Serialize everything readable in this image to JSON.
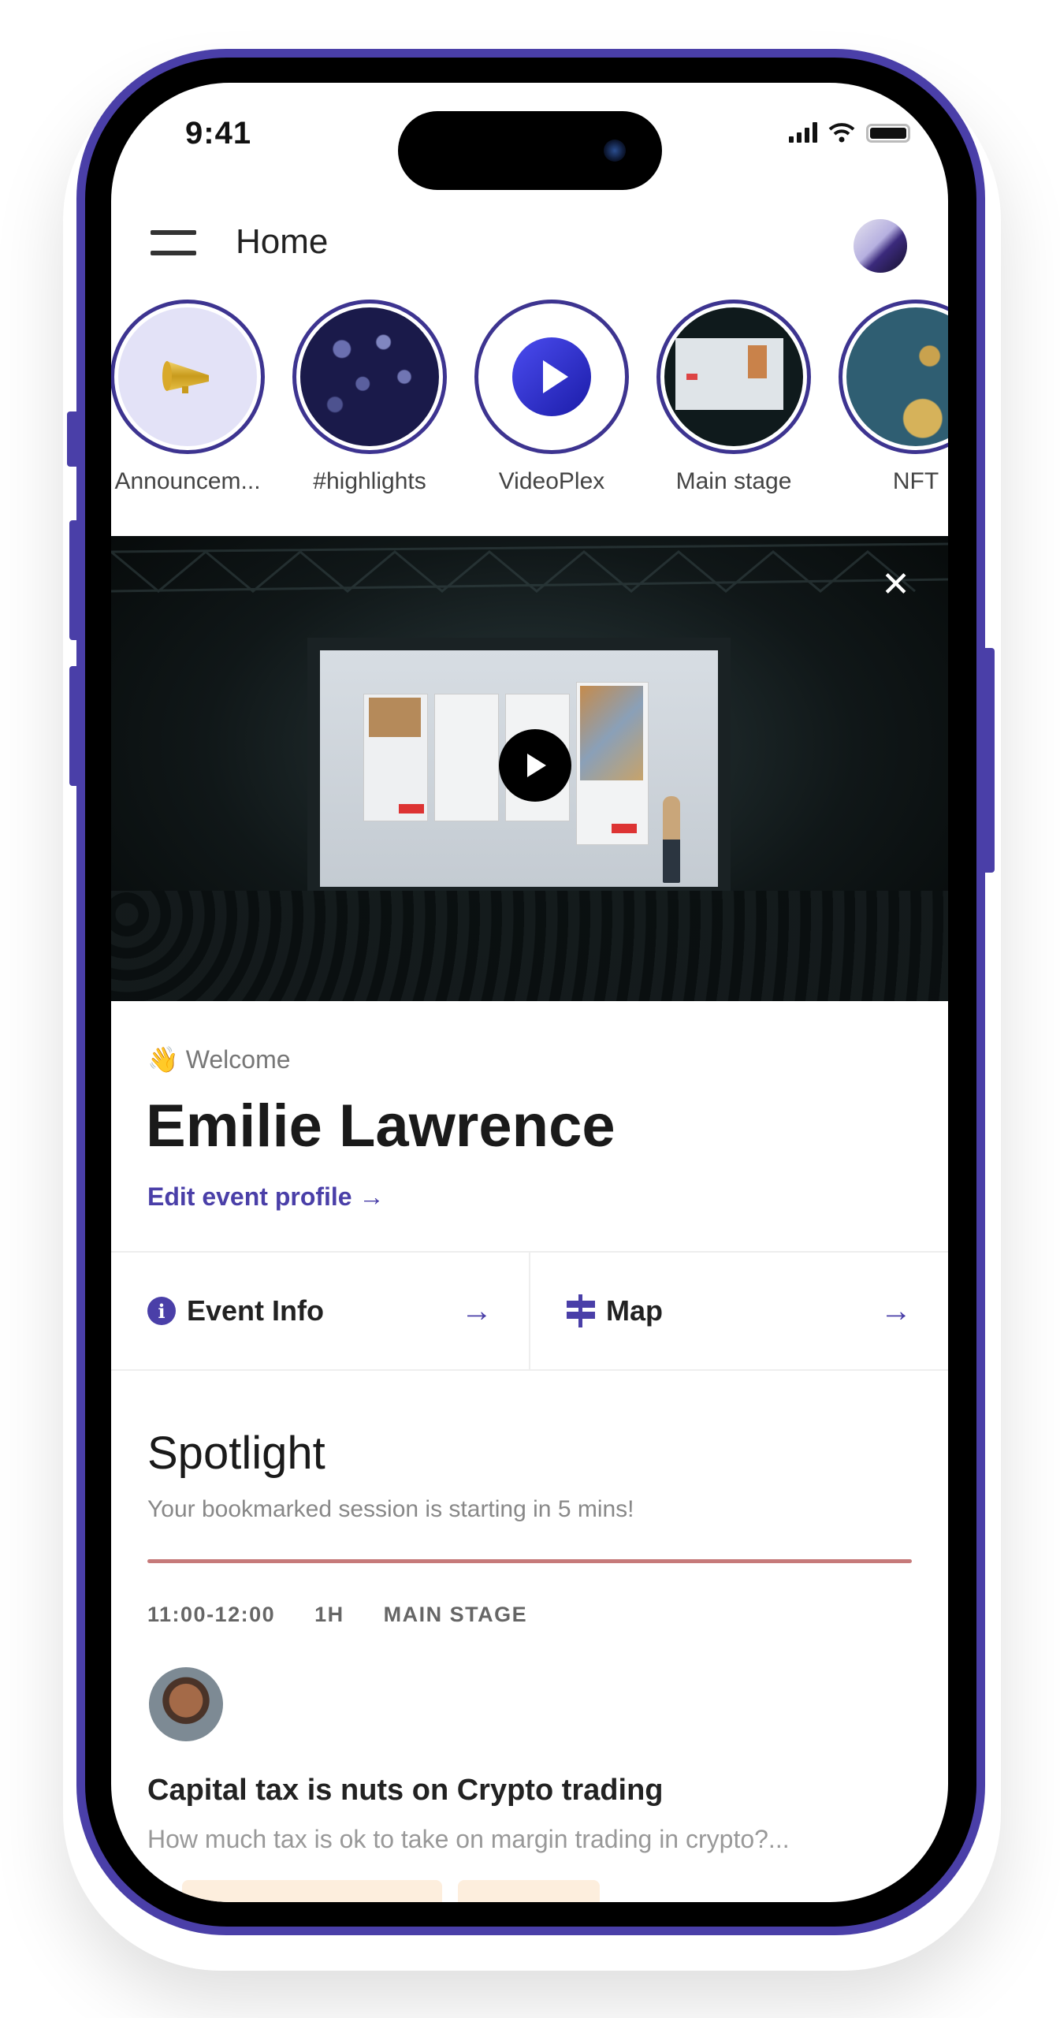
{
  "status_bar": {
    "time": "9:41",
    "icons": [
      "signal-icon",
      "wifi-icon",
      "battery-icon"
    ]
  },
  "header": {
    "title": "Home",
    "menu_icon": "hamburger-menu-icon",
    "avatar": "user-avatar"
  },
  "stories": [
    {
      "label": "Announcem...",
      "icon": "megaphone-icon"
    },
    {
      "label": "#highlights",
      "icon": "crowd-thumbnail"
    },
    {
      "label": "VideoPlex",
      "icon": "play-logo-icon"
    },
    {
      "label": "Main stage",
      "icon": "stage-thumbnail"
    },
    {
      "label": "NFT",
      "icon": "nft-thumbnail"
    }
  ],
  "video": {
    "play_icon": "play-icon",
    "close_icon": "close-icon",
    "close_glyph": "✕"
  },
  "welcome": {
    "greeting_emoji": "👋",
    "greeting": "Welcome",
    "name": "Emilie Lawrence",
    "edit_link": "Edit event profile →"
  },
  "tiles": [
    {
      "label": "Event Info",
      "icon": "info-icon",
      "icon_glyph": "i",
      "arrow": "→"
    },
    {
      "label": "Map",
      "icon": "signpost-icon",
      "arrow": "→"
    }
  ],
  "spotlight": {
    "title": "Spotlight",
    "subtitle": "Your bookmarked session is starting in 5 mins!",
    "session": {
      "time": "11:00-12:00",
      "duration": "1H",
      "location": "MAIN STAGE",
      "title": "Capital tax is nuts on Crypto trading",
      "description": "How much tax is ok to take on margin trading in crypto?..."
    }
  },
  "colors": {
    "accent": "#4a3fa8",
    "frame": "#4a3fa8",
    "progress_line": "#c67a7a"
  }
}
